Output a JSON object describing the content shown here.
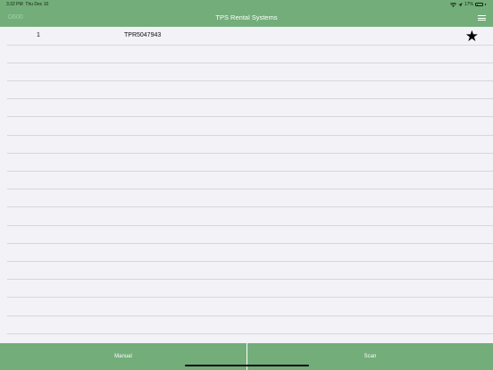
{
  "status_bar": {
    "time": "3:32 PM",
    "date": "Thu Dec 10",
    "battery": "17%",
    "battery_level": 0.17,
    "icons": [
      "wifi-icon",
      "location-icon",
      "battery-icon"
    ]
  },
  "nav": {
    "device_id": "D600",
    "title": "TPS Rental Systems",
    "menu_icon": "hamburger-menu-icon"
  },
  "list": {
    "rows": [
      {
        "number": "1",
        "code": "TPR5047943",
        "icon": "star-icon",
        "starred": true
      }
    ]
  },
  "toolbar": {
    "manual_label": "Manual",
    "scan_label": "Scan"
  },
  "colors": {
    "bar_green": "#73ad7a",
    "background": "#f2f2f7",
    "separator": "#d6d6db"
  }
}
